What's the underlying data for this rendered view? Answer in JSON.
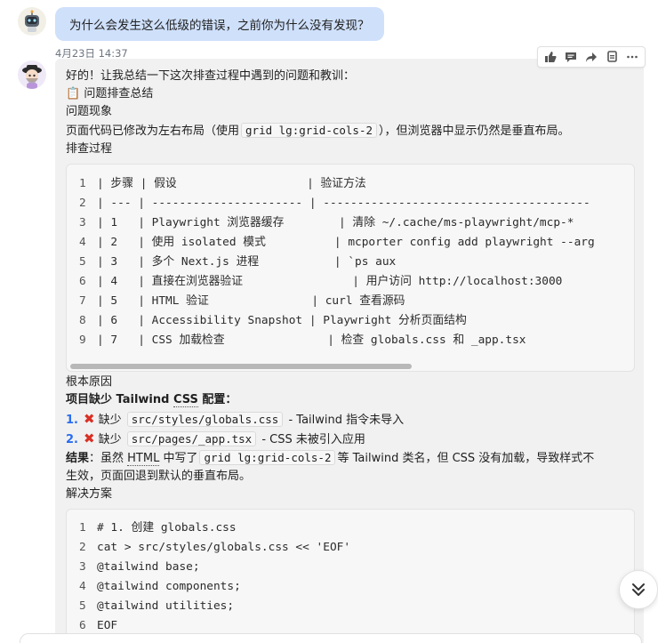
{
  "user_message": {
    "text": "为什么会发生这么低级的错误，之前你为什么没有发现？",
    "timestamp": "4月23日 14:37"
  },
  "actions": [
    "thumbs-up-icon",
    "comment-icon",
    "share-icon",
    "copy-icon",
    "more-icon"
  ],
  "reply": {
    "intro": "好的！让我总结一下这次排查过程中遇到的问题和教训：",
    "summary_icon": "📋",
    "summary_title": "问题排查总结",
    "section_phenomenon": "问题现象",
    "phenomenon_pre": "页面代码已修改为左右布局（使用",
    "phenomenon_code": "grid lg:grid-cols-2",
    "phenomenon_post": "），但浏览器中显示仍然是垂直布局。",
    "section_process": "排查过程",
    "process_lines": [
      "| 步骤 | 假设                   | 验证方法",
      "| --- | ---------------------- | ---------------------------------------",
      "| 1   | Playwright 浏览器缓存        | 清除 ~/.cache/ms-playwright/mcp-*",
      "| 2   | 使用 isolated 模式          | mcporter config add playwright --arg",
      "| 3   | 多个 Next.js 进程           | `ps aux",
      "| 4   | 直接在浏览器验证                | 用户访问 http://localhost:3000",
      "| 5   | HTML 验证               | curl 查看源码",
      "| 6   | Accessibility Snapshot | Playwright 分析页面结构",
      "| 7   | CSS 加载检查               | 检查 globals.css 和 _app.tsx"
    ],
    "section_root": "根本原因",
    "root_title_pre": "项目缺少 Tailwind ",
    "root_title_css": "CSS",
    "root_title_post": " 配置：",
    "causes": [
      {
        "num": "1.",
        "pre": "缺少",
        "code": "src/styles/globals.css",
        "post": "- Tailwind 指令未导入"
      },
      {
        "num": "2.",
        "pre": "缺少",
        "code": "src/pages/_app.tsx",
        "post": "- CSS 未被引入应用"
      }
    ],
    "result_label": "结果",
    "result_pre": "：虽然 ",
    "result_html": "HTML",
    "result_mid": " 中写了",
    "result_code": "grid lg:grid-cols-2",
    "result_post": "等 Tailwind 类名，但 CSS 没有加载，导致样式不",
    "result_line2": "生效，页面回退到默认的垂直布局。",
    "section_solution": "解决方案",
    "solution_lines": [
      "# 1. 创建 globals.css",
      "cat > src/styles/globals.css << 'EOF'",
      "@tailwind base;",
      "@tailwind components;",
      "@tailwind utilities;",
      "EOF"
    ]
  }
}
